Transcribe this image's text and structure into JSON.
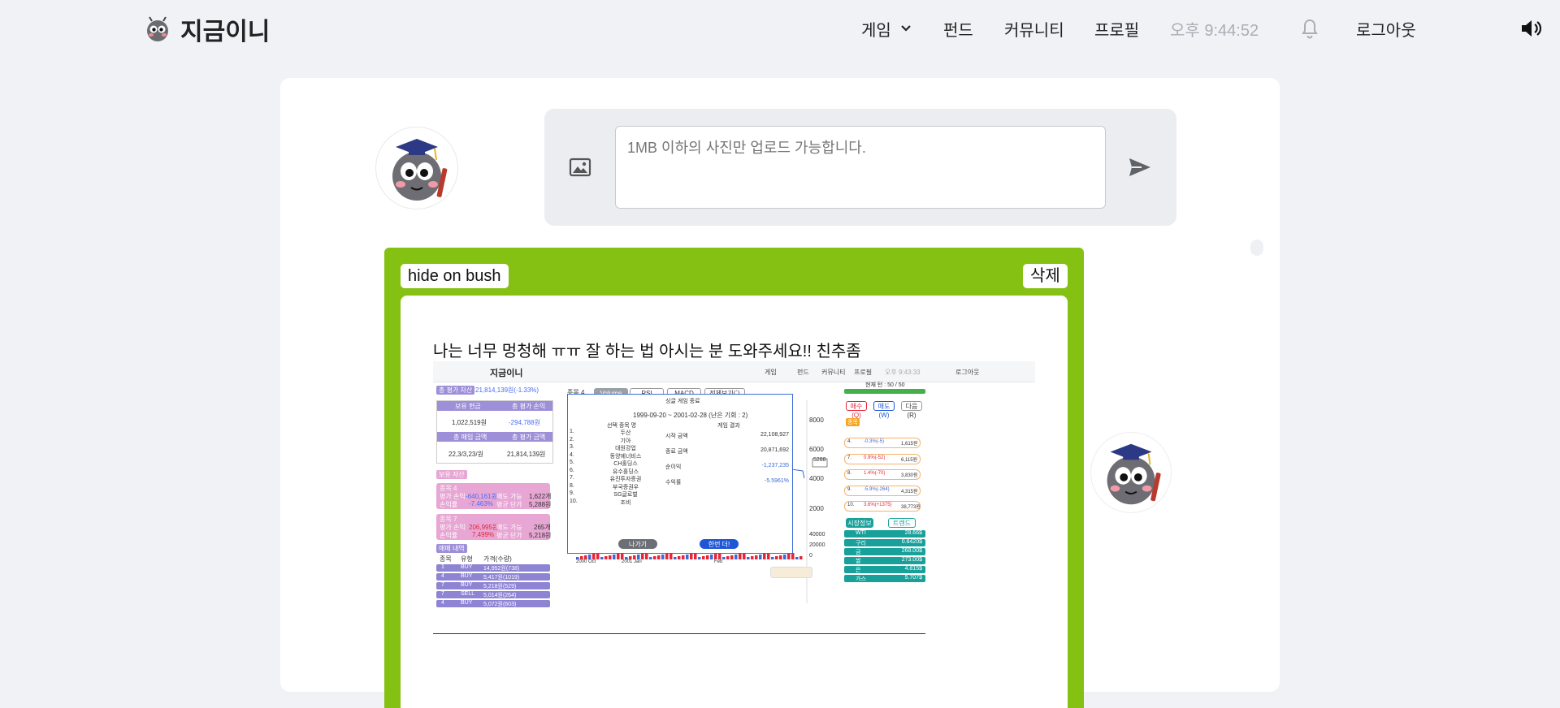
{
  "header": {
    "brand": "지금이니",
    "nav": {
      "game": "게임",
      "fund": "펀드",
      "community": "커뮤니티",
      "profile": "프로필",
      "clock": "오후 9:44:52",
      "logout": "로그아웃"
    }
  },
  "compose": {
    "placeholder": "1MB 이하의 사진만 업로드 가능합니다."
  },
  "post": {
    "author": "hide on bush",
    "delete_label": "삭제",
    "title": "나는 너무 멍청해 ㅠㅠ 잘 하는 법 아시는 분 도와주세요!! 친추좀"
  },
  "attached_screenshot": {
    "brand": "지금이니",
    "nav": {
      "game": "게임",
      "fund": "펀드",
      "community": "커뮤니티",
      "profile": "프로필",
      "clock": "오후 9:43:33",
      "logout": "로그아웃"
    },
    "total_assets_label": "총 평가 자산",
    "total_assets_value": "21,814,139원(-1.33%)",
    "holdings_table": {
      "h1": "보유 현금",
      "h2": "총 평가 손익",
      "v1": "1,022,519원",
      "v2": "-294,788원",
      "h3": "총 매입 금액",
      "h4": "총 평가 금액",
      "v3": "22,3/3,23/원",
      "v4": "21,814,139원"
    },
    "held_stocks_label": "보유 자산",
    "stock4": {
      "name": "종목 4",
      "pl_label": "평가 손익",
      "pl": "-640,161원",
      "sell_label": "매도 가능",
      "sell": "1,622개",
      "rate_label": "손익률",
      "rate": "-7.463%",
      "avg_label": "평균 단가",
      "avg": "5,288원"
    },
    "stock7": {
      "name": "종목 7",
      "pl_label": "평가 손익",
      "pl": "206,995원",
      "sell_label": "매도 가능",
      "sell": "265개",
      "rate_label": "손익률",
      "rate": "7.499%",
      "avg_label": "평균 단가",
      "avg": "5,218원"
    },
    "trade_history_label": "매매 내역",
    "trade_cols": [
      "종목",
      "유형",
      "가격(수량)"
    ],
    "trades": [
      {
        "stock": "1",
        "type": "BUY",
        "price": "14,952원(738)"
      },
      {
        "stock": "4",
        "type": "BUY",
        "price": "5,417원(1019)"
      },
      {
        "stock": "7",
        "type": "BUY",
        "price": "5,218원(529)"
      },
      {
        "stock": "7",
        "type": "SELL",
        "price": "5,014원(264)"
      },
      {
        "stock": "4",
        "type": "BUY",
        "price": "5,072원(603)"
      }
    ],
    "chart_stock": "종목 4",
    "chart_tabs": [
      "Volume",
      "RSI",
      "MACD",
      "전체보기(`)"
    ],
    "y_ticks": [
      "8000",
      "6000",
      "4000",
      "2000"
    ],
    "vol_ticks": [
      "40000",
      "20000",
      "0"
    ],
    "x_ticks": [
      "2000 Oct",
      "2001 Jan",
      "Feb"
    ],
    "price_tag": "5288",
    "modal": {
      "title": "싱글 게임 종료",
      "period": "1999-09-20 ~ 2001-02-28 (난은 기회 : 2)",
      "left_head": "선택 종목 명",
      "right_head": "게임 결과",
      "stocks": [
        "두산",
        "기아",
        "대원강업",
        "동양에너비스",
        "CH홀딩스",
        "유수홀딩스",
        "유진투자증권",
        "부국증권우",
        "SG글로벌",
        "조비"
      ],
      "results": [
        {
          "k": "시작 금액",
          "v": "22,108,927"
        },
        {
          "k": "종료 금액",
          "v": "20,871,692"
        },
        {
          "k": "순이익",
          "v": "-1,237,235"
        },
        {
          "k": "수익률",
          "v": "-5.5961%"
        }
      ],
      "exit_label": "나가기",
      "retry_label": "한번 더!"
    },
    "turn_label": "현재 턴 : 50 / 50",
    "action_buttons": [
      "매수(Q)",
      "매도(W)",
      "다음(R)"
    ],
    "stocks_label": "종목",
    "stock_rows": [
      {
        "n": "4.",
        "c": "-0.3%(-5)",
        "p": "1,615원"
      },
      {
        "n": "7.",
        "c": "0.9%(-52)",
        "p": "6,115원"
      },
      {
        "n": "8.",
        "c": "1.4%(-70)",
        "p": "3,830원"
      },
      {
        "n": "9.",
        "c": "-5.9%(-264)",
        "p": "4,315원"
      },
      {
        "n": "10.",
        "c": "3.6%(+1375)",
        "p": "38,773원"
      }
    ],
    "market_tabs": [
      "시장정보",
      "트렌드"
    ],
    "market": [
      {
        "k": "WTI",
        "v": "28.66$"
      },
      {
        "k": "구리",
        "v": "0.8420$"
      },
      {
        "k": "금",
        "v": "268.00$"
      },
      {
        "k": "쌀",
        "v": "273.00$"
      },
      {
        "k": "은",
        "v": "4.815$"
      },
      {
        "k": "가스",
        "v": "5.707$"
      }
    ]
  }
}
